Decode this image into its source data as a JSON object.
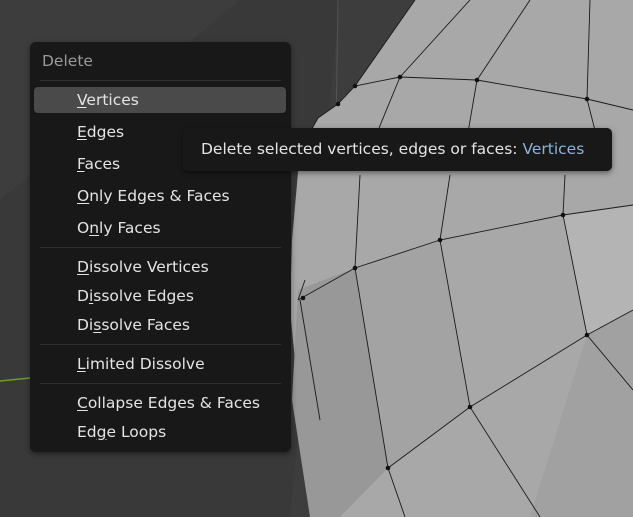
{
  "menu": {
    "title": "Delete",
    "items": [
      {
        "pre": "",
        "ul": "V",
        "post": "ertices",
        "highlighted": true
      },
      {
        "pre": "",
        "ul": "E",
        "post": "dges",
        "highlighted": false
      },
      {
        "pre": "",
        "ul": "F",
        "post": "aces",
        "highlighted": false
      },
      {
        "pre": "",
        "ul": "O",
        "post": "nly Edges & Faces",
        "highlighted": false
      },
      {
        "pre": "O",
        "ul": "n",
        "post": "ly Faces",
        "highlighted": false
      },
      {
        "pre": "",
        "ul": "D",
        "post": "issolve Vertices",
        "highlighted": false
      },
      {
        "pre": "D",
        "ul": "i",
        "post": "ssolve Edges",
        "highlighted": false
      },
      {
        "pre": "Di",
        "ul": "s",
        "post": "solve Faces",
        "highlighted": false
      },
      {
        "pre": "",
        "ul": "L",
        "post": "imited Dissolve",
        "highlighted": false
      },
      {
        "pre": "",
        "ul": "C",
        "post": "ollapse Edges & Faces",
        "highlighted": false
      },
      {
        "pre": "Ed",
        "ul": "g",
        "post": "e Loops",
        "highlighted": false
      }
    ]
  },
  "tooltip": {
    "text": "Delete selected vertices, edges or faces: ",
    "value": "Vertices",
    "value_color": "#8fb2dc"
  },
  "colors": {
    "background": "#3d3d3d",
    "mesh_face": "#a6a7a6",
    "menu_bg": "#181818",
    "highlight": "#4a4a4a"
  }
}
